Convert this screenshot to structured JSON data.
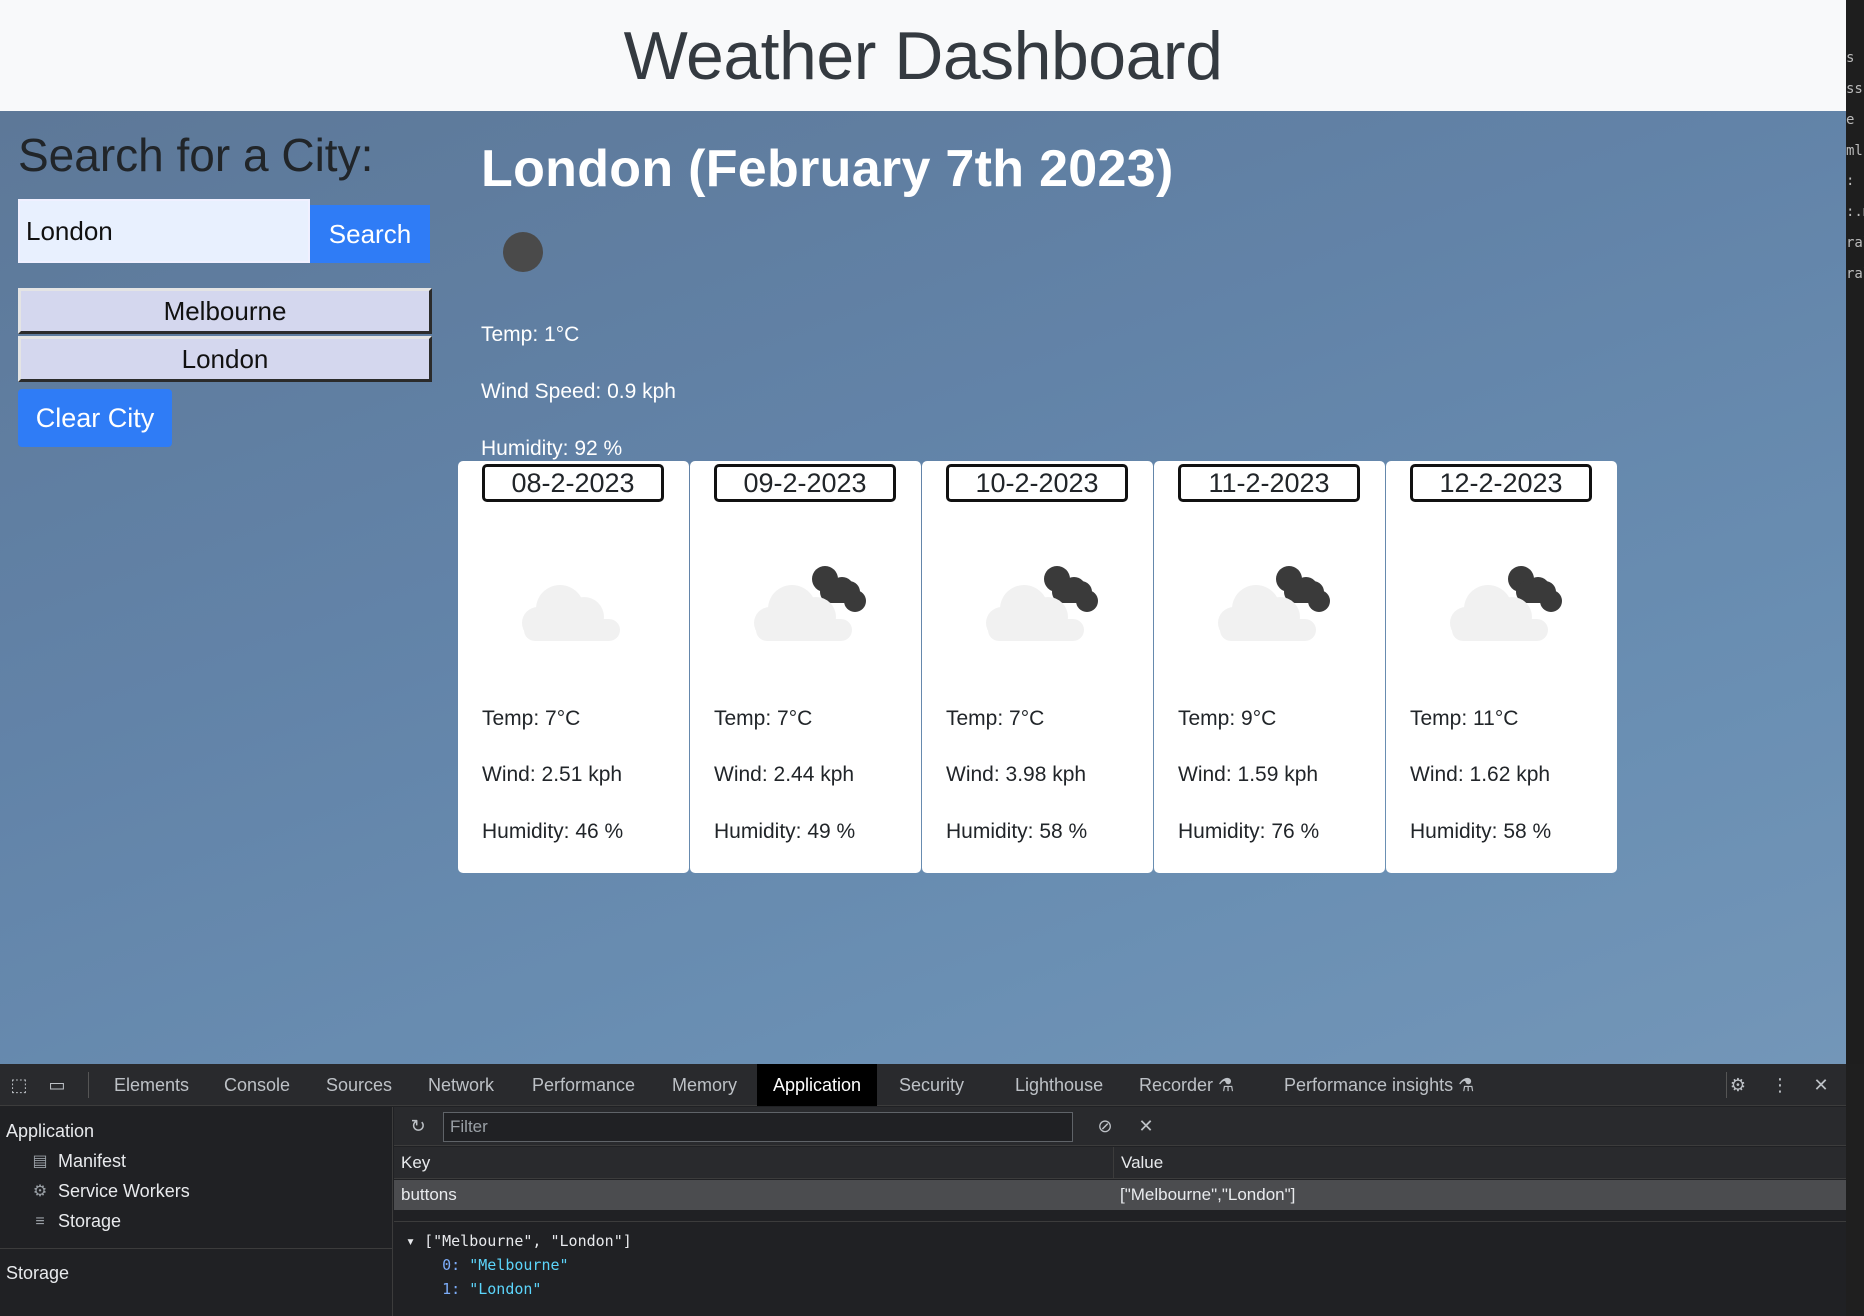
{
  "header": {
    "title": "Weather Dashboard"
  },
  "sidebar": {
    "title": "Search for a City:",
    "search_value": "London",
    "search_button": "Search",
    "history": [
      "Melbourne",
      "London"
    ],
    "clear_button": "Clear City"
  },
  "current": {
    "title": "London (February 7th 2023)",
    "temp": "Temp: 1°C",
    "wind": "Wind Speed: 0.9 kph",
    "humidity": "Humidity: 92 %"
  },
  "forecast": [
    {
      "date": "08-2-2023",
      "icon": "cloud-icon",
      "temp": "Temp: 7°C",
      "wind": "Wind: 2.51 kph",
      "humidity": "Humidity: 46 %"
    },
    {
      "date": "09-2-2023",
      "icon": "broken-clouds-icon",
      "temp": "Temp: 7°C",
      "wind": "Wind: 2.44 kph",
      "humidity": "Humidity: 49 %"
    },
    {
      "date": "10-2-2023",
      "icon": "broken-clouds-icon",
      "temp": "Temp: 7°C",
      "wind": "Wind: 3.98 kph",
      "humidity": "Humidity: 58 %"
    },
    {
      "date": "11-2-2023",
      "icon": "broken-clouds-icon",
      "temp": "Temp: 9°C",
      "wind": "Wind: 1.59 kph",
      "humidity": "Humidity: 76 %"
    },
    {
      "date": "12-2-2023",
      "icon": "broken-clouds-icon",
      "temp": "Temp: 11°C",
      "wind": "Wind: 1.62 kph",
      "humidity": "Humidity: 58 %"
    }
  ],
  "edge_text": [
    "s",
    "ss",
    "e",
    "ml",
    ":",
    ":.m",
    "ral",
    "ral"
  ],
  "devtools": {
    "tabs": [
      "Elements",
      "Console",
      "Sources",
      "Network",
      "Performance",
      "Memory",
      "Application",
      "Security",
      "Lighthouse",
      "Recorder",
      "Performance insights"
    ],
    "active_tab": "Application",
    "sidebar": {
      "application_heading": "Application",
      "items": [
        "Manifest",
        "Service Workers",
        "Storage"
      ],
      "storage_heading": "Storage"
    },
    "filter_placeholder": "Filter",
    "table": {
      "key_header": "Key",
      "value_header": "Value",
      "row_key": "buttons",
      "row_value": "[\"Melbourne\",\"London\"]"
    },
    "preview": {
      "summary": "[\"Melbourne\", \"London\"]",
      "items": [
        {
          "index": "0",
          "value": "\"Melbourne\""
        },
        {
          "index": "1",
          "value": "\"London\""
        }
      ]
    }
  },
  "colors": {
    "primary_button": "#2f7cf6",
    "header_bg": "#f8f9fa",
    "history_bg": "#d4d7ee",
    "devtools_bg": "#202124"
  }
}
